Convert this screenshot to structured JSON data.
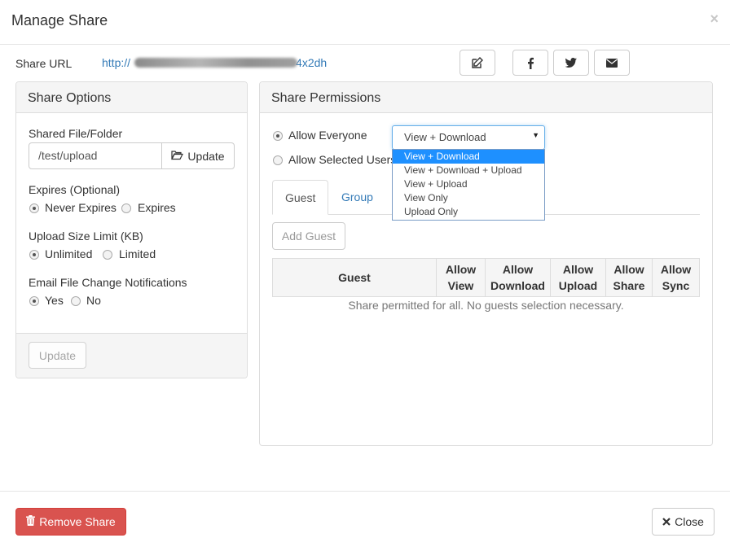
{
  "modal": {
    "title": "Manage Share",
    "close_glyph": "×"
  },
  "share_url": {
    "label": "Share URL",
    "link_prefix": "http://",
    "link_suffix": "4x2dh"
  },
  "toolbar": {
    "icons": [
      "edit-icon",
      "facebook-icon",
      "twitter-icon",
      "envelope-icon"
    ]
  },
  "options": {
    "heading": "Share Options",
    "file_label": "Shared File/Folder",
    "file_value": "/test/upload",
    "file_button": "Update",
    "expires_label": "Expires (Optional)",
    "expires_opts": [
      "Never Expires",
      "Expires"
    ],
    "upload_label": "Upload Size Limit (KB)",
    "upload_opts": [
      "Unlimited",
      "Limited"
    ],
    "email_label": "Email File Change Notifications",
    "email_opts": [
      "Yes",
      "No"
    ],
    "update_button": "Update"
  },
  "permissions": {
    "heading": "Share Permissions",
    "allow_everyone": "Allow Everyone",
    "allow_selected": "Allow Selected Users",
    "selected_option": "View + Download",
    "dropdown_options": [
      "View + Download",
      "View + Download + Upload",
      "View + Upload",
      "View Only",
      "Upload Only"
    ],
    "tabs": [
      "Guest",
      "Group"
    ],
    "add_guest": "Add Guest",
    "columns": [
      "Guest",
      "Allow View",
      "Allow Download",
      "Allow Upload",
      "Allow Share",
      "Allow Sync"
    ],
    "empty_message": "Share permitted for all. No guests selection necessary."
  },
  "footer": {
    "remove_button": "Remove Share",
    "close_button": "Close"
  },
  "colors": {
    "danger": "#d9534f",
    "link": "#337ab7",
    "highlight": "#1e90ff"
  }
}
